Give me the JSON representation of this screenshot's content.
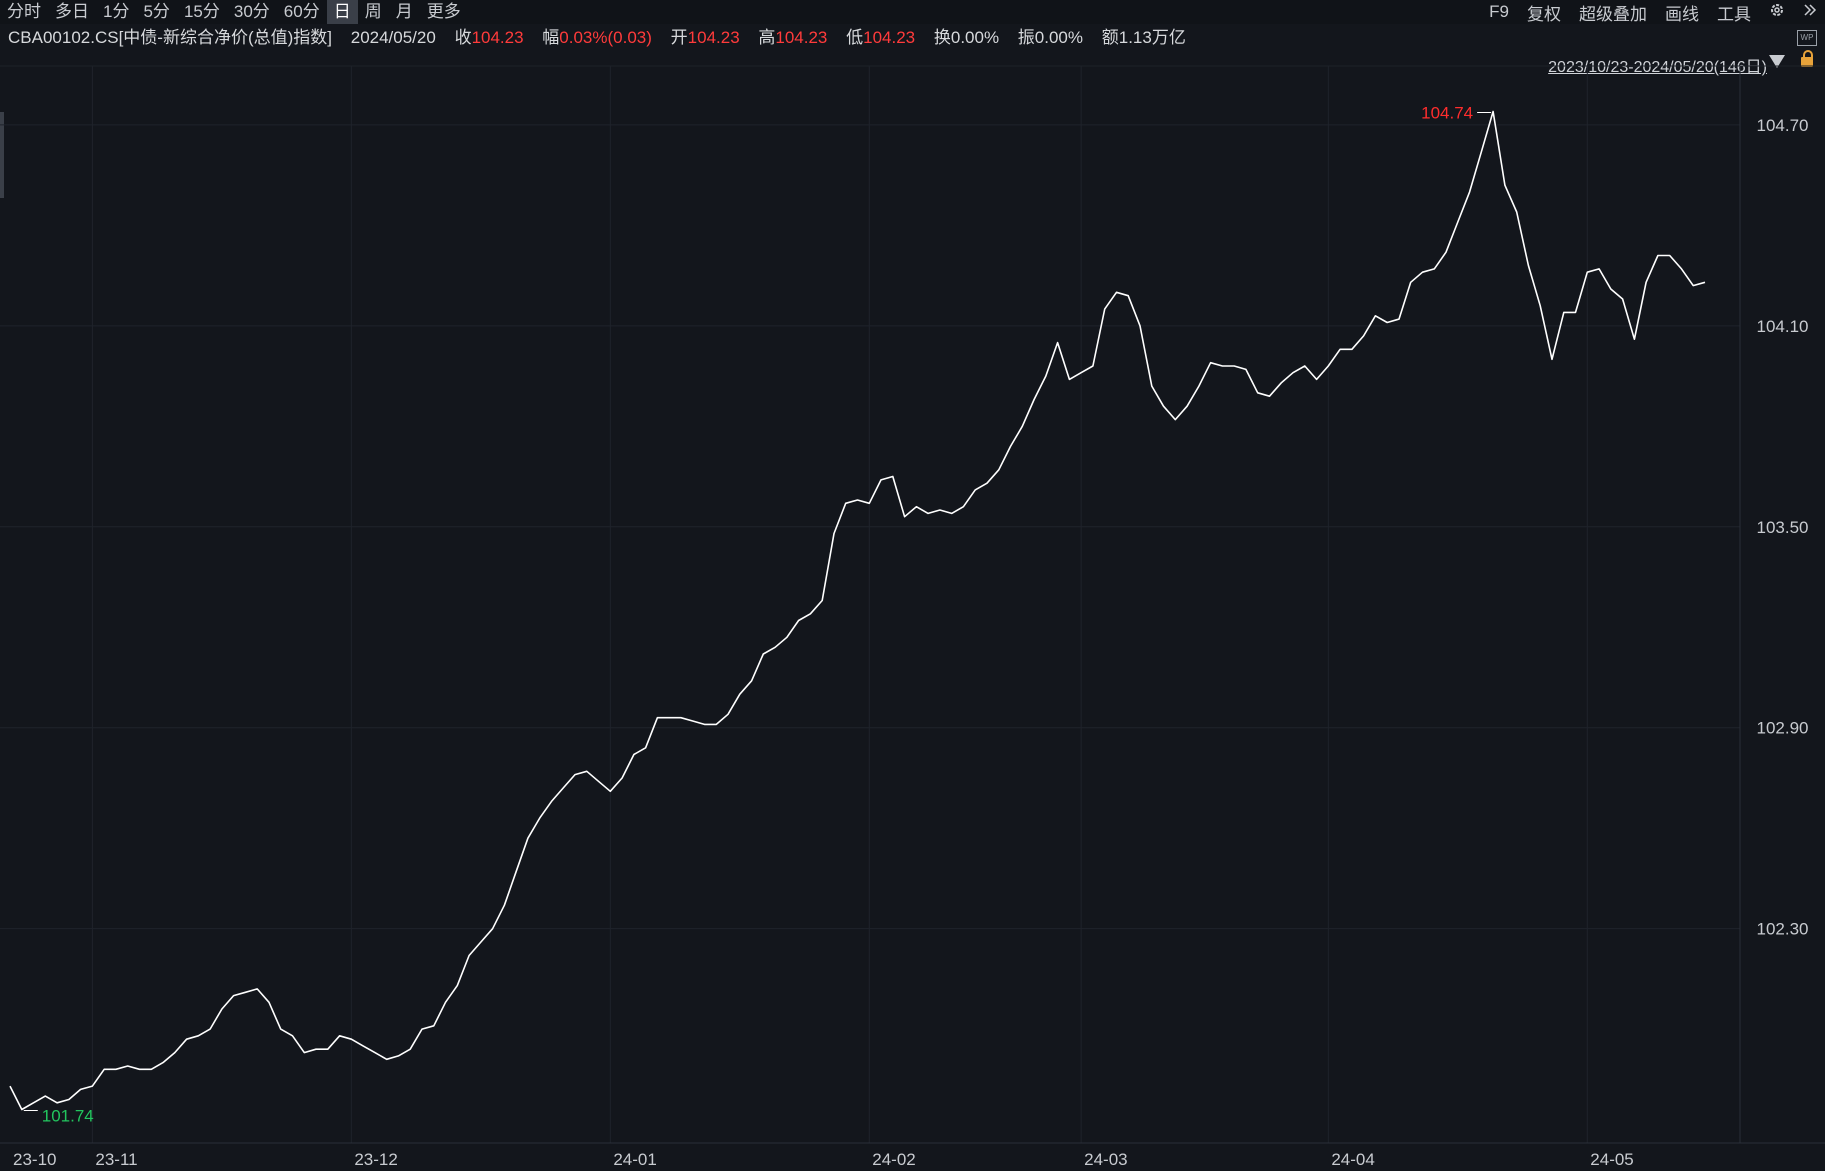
{
  "toolbar": {
    "periods": [
      "分时",
      "多日",
      "1分",
      "5分",
      "15分",
      "30分",
      "60分",
      "日",
      "周",
      "月",
      "更多"
    ],
    "active_period": "日",
    "right_tools": [
      "F9",
      "复权",
      "超级叠加",
      "画线",
      "工具"
    ],
    "settings_icon": "gear-icon",
    "expand_icon": "double-chevron-right-icon"
  },
  "info": {
    "symbol": "CBA00102.CS[中债-新综合净价(总值)指数]",
    "date": "2024/05/20",
    "close_label": "收",
    "close": "104.23",
    "change_label": "幅",
    "change": "0.03%(0.03)",
    "open_label": "开",
    "open": "104.23",
    "high_label": "高",
    "high": "104.23",
    "low_label": "低",
    "low": "104.23",
    "turnover_label": "换",
    "turnover": "0.00%",
    "amplitude_label": "振",
    "amplitude": "0.00%",
    "amount_label": "额",
    "amount": "1.13万亿"
  },
  "range_label": "2023/10/23-2024/05/20(146日)",
  "colors": {
    "line": "#ffffff",
    "max": "#ff2d2d",
    "min": "#22c55e",
    "grid": "#1f232b",
    "text": "#c8cbd0"
  },
  "chart_data": {
    "type": "line",
    "title": "",
    "ylim": [
      101.66,
      104.84
    ],
    "yticks": [
      104.7,
      104.1,
      103.5,
      102.9,
      102.3
    ],
    "ytick_labels": [
      "104.70",
      "104.10",
      "103.50",
      "102.90",
      "102.30"
    ],
    "xtick_labels": [
      {
        "label": "23-10",
        "index": 0
      },
      {
        "label": "23-11",
        "index": 7
      },
      {
        "label": "23-12",
        "index": 29
      },
      {
        "label": "24-01",
        "index": 51
      },
      {
        "label": "24-02",
        "index": 73
      },
      {
        "label": "24-03",
        "index": 91
      },
      {
        "label": "24-04",
        "index": 112
      },
      {
        "label": "24-05",
        "index": 134
      }
    ],
    "max_label": "104.74",
    "min_label": "101.74",
    "values": [
      101.83,
      101.76,
      101.78,
      101.8,
      101.78,
      101.79,
      101.82,
      101.83,
      101.88,
      101.88,
      101.89,
      101.88,
      101.88,
      101.9,
      101.93,
      101.97,
      101.98,
      102.0,
      102.06,
      102.1,
      102.11,
      102.12,
      102.08,
      102.0,
      101.98,
      101.93,
      101.94,
      101.94,
      101.98,
      101.97,
      101.95,
      101.93,
      101.91,
      101.92,
      101.94,
      102.0,
      102.01,
      102.08,
      102.13,
      102.22,
      102.26,
      102.3,
      102.37,
      102.47,
      102.57,
      102.63,
      102.68,
      102.72,
      102.76,
      102.77,
      102.74,
      102.71,
      102.75,
      102.82,
      102.84,
      102.93,
      102.93,
      102.93,
      102.92,
      102.91,
      102.91,
      102.94,
      103.0,
      103.04,
      103.12,
      103.14,
      103.17,
      103.22,
      103.24,
      103.28,
      103.48,
      103.57,
      103.58,
      103.57,
      103.64,
      103.65,
      103.53,
      103.56,
      103.54,
      103.55,
      103.54,
      103.56,
      103.61,
      103.63,
      103.67,
      103.74,
      103.8,
      103.88,
      103.95,
      104.05,
      103.94,
      103.96,
      103.98,
      104.15,
      104.2,
      104.19,
      104.1,
      103.92,
      103.86,
      103.82,
      103.86,
      103.92,
      103.99,
      103.98,
      103.98,
      103.97,
      103.9,
      103.89,
      103.93,
      103.96,
      103.98,
      103.94,
      103.98,
      104.03,
      104.03,
      104.07,
      104.13,
      104.11,
      104.12,
      104.23,
      104.26,
      104.27,
      104.32,
      104.41,
      104.5,
      104.62,
      104.74,
      104.52,
      104.44,
      104.28,
      104.16,
      104.0,
      104.14,
      104.14,
      104.26,
      104.27,
      104.21,
      104.18,
      104.06,
      104.23,
      104.31,
      104.31,
      104.27,
      104.22,
      104.23
    ]
  }
}
